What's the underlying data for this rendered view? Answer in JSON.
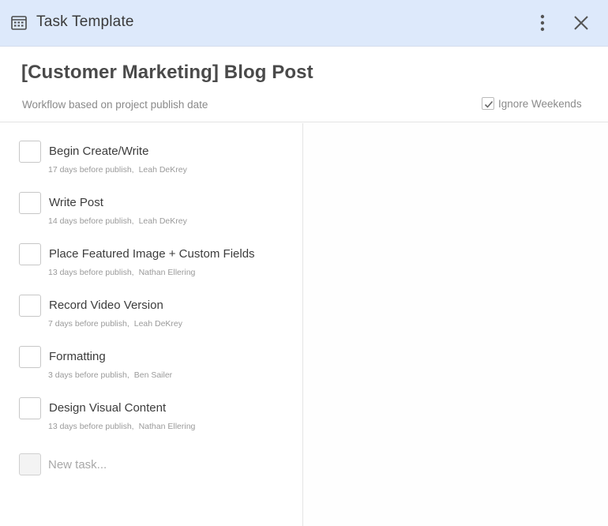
{
  "window": {
    "title": "Task Template",
    "icon": "calendar-grid-icon",
    "menu_icon": "more-vertical-icon",
    "close_icon": "close-icon"
  },
  "header": {
    "title": "[Customer Marketing] Blog Post",
    "subtitle": "Workflow based on project publish date",
    "ignore_weekends_label": "Ignore Weekends",
    "ignore_weekends_checked": true
  },
  "tasks": [
    {
      "name": "Begin Create/Write",
      "timing": "17 days before publish,",
      "assignee": "Leah DeKrey"
    },
    {
      "name": "Write Post",
      "timing": "14 days before publish,",
      "assignee": "Leah DeKrey"
    },
    {
      "name": "Place Featured Image + Custom Fields",
      "timing": "13 days before publish,",
      "assignee": "Nathan Ellering"
    },
    {
      "name": "Record Video Version",
      "timing": "7 days before publish,",
      "assignee": "Leah DeKrey"
    },
    {
      "name": "Formatting",
      "timing": "3 days before publish,",
      "assignee": "Ben Sailer"
    },
    {
      "name": "Design Visual Content",
      "timing": "13 days before publish,",
      "assignee": "Nathan Ellering"
    }
  ],
  "new_task": {
    "placeholder": "New task..."
  },
  "colors": {
    "titlebar_bg": "#dde9fb",
    "title_text": "#4a4a4a",
    "muted_text": "#8a8a8a"
  }
}
